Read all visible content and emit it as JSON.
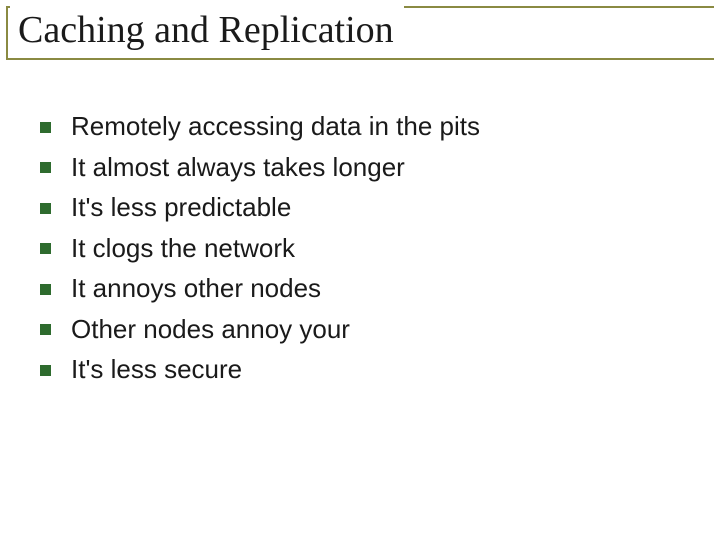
{
  "title": "Caching and Replication",
  "bullets": [
    "Remotely accessing data in the pits",
    "It almost always takes longer",
    "It's less predictable",
    "It clogs the network",
    "It annoys other nodes",
    "Other nodes annoy your",
    "It's less secure"
  ],
  "colors": {
    "rule": "#8a8a42",
    "bullet_square": "#2e6b2e",
    "text": "#1a1a1a"
  }
}
